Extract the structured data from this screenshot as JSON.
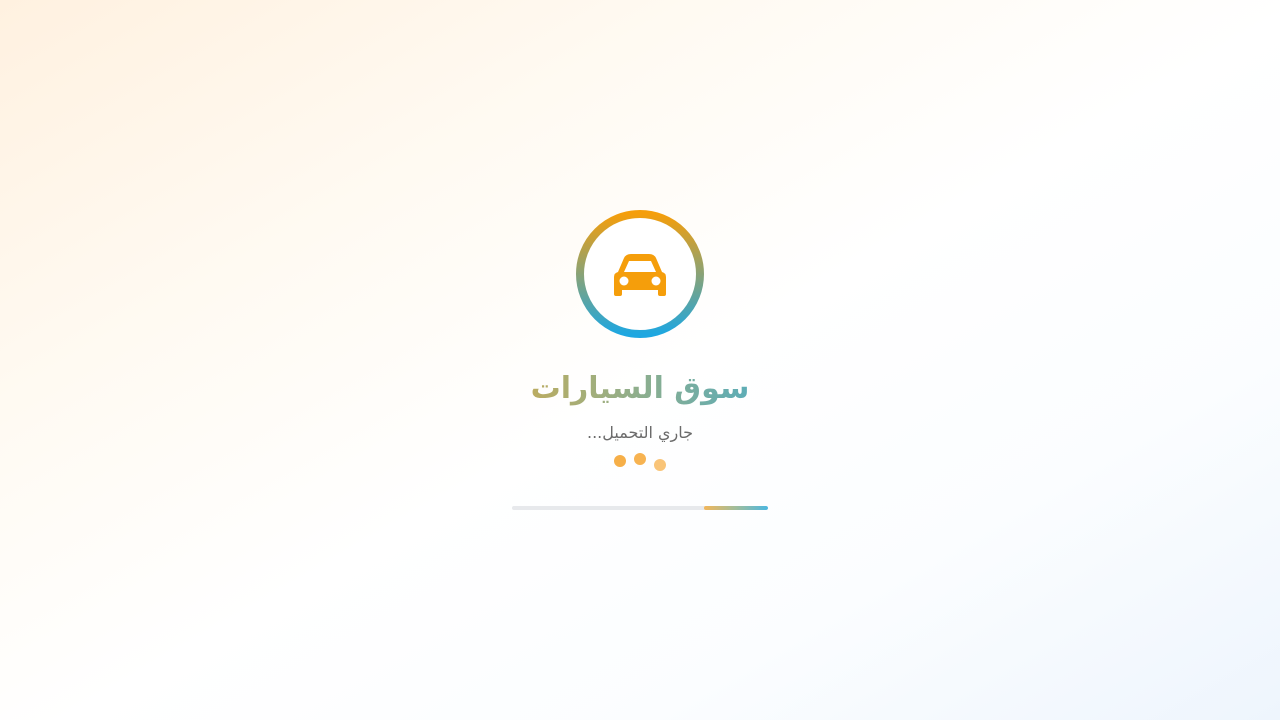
{
  "app": {
    "title": "سوق السيارات",
    "loading_text": "جاري التحميل...",
    "logo_icon": "car-icon"
  },
  "progress": {
    "value": 0.25
  },
  "colors": {
    "accent_orange": "#f59e0b",
    "accent_blue": "#1ea7e1",
    "text_muted": "#6b6b6b",
    "track": "#e7e9ec"
  }
}
